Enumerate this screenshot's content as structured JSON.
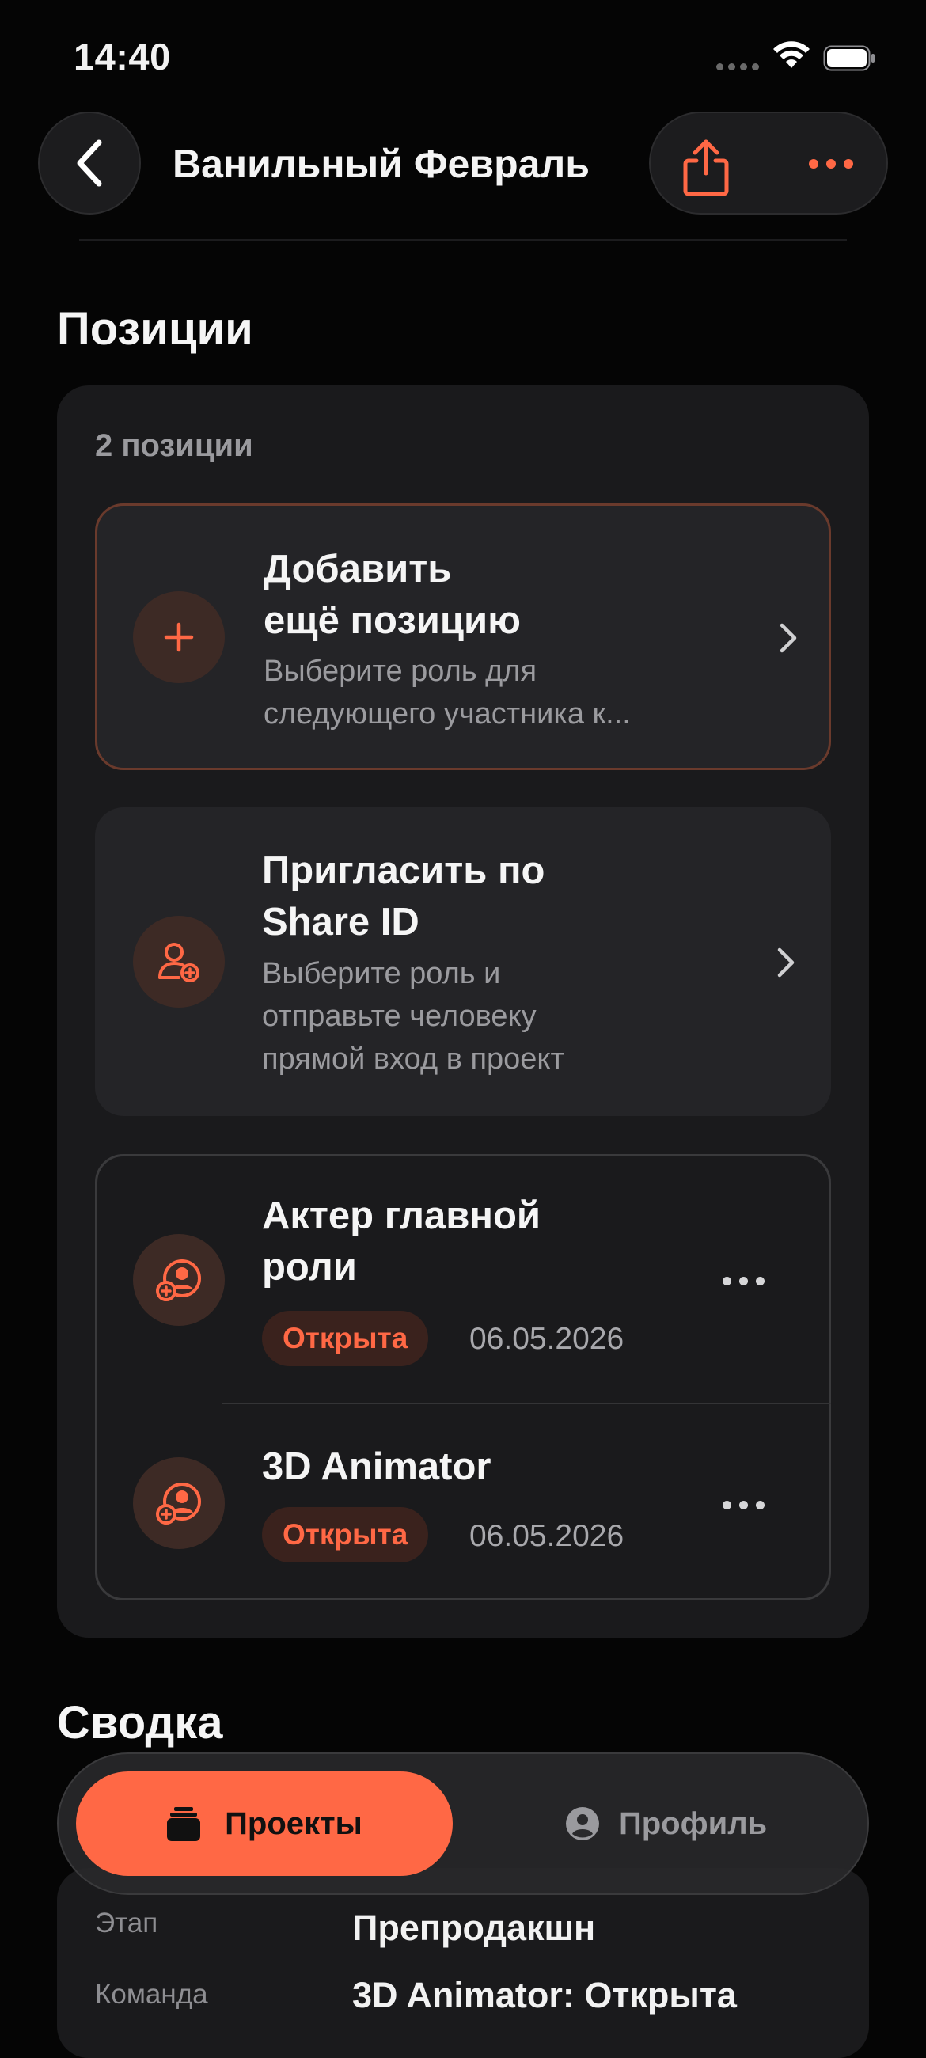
{
  "status_bar": {
    "time": "14:40"
  },
  "header": {
    "title": "Ванильный Февраль"
  },
  "positions": {
    "section_title": "Позиции",
    "count_label": "2 позиции",
    "add": {
      "title_line1": "Добавить",
      "title_line2": "ещё позицию",
      "sub_line1": "Выберите роль для",
      "sub_line2": "следующего участника к..."
    },
    "invite": {
      "title_line1": "Пригласить по",
      "title_line2": "Share ID",
      "sub_line1": "Выберите роль и",
      "sub_line2": "отправьте человеку",
      "sub_line3": "прямой вход в проект"
    },
    "roles": [
      {
        "title_line1": "Актер главной",
        "title_line2": "роли",
        "status": "Открыта",
        "date": "06.05.2026"
      },
      {
        "title_line1": "3D Animator",
        "title_line2": "",
        "status": "Открыта",
        "date": "06.05.2026"
      }
    ]
  },
  "summary": {
    "section_title": "Сводка",
    "rows": [
      {
        "label": "Этап",
        "value": "Препродакшн"
      },
      {
        "label": "Команда",
        "value": "3D Animator: Открыта"
      }
    ]
  },
  "tabbar": {
    "projects_label": "Проекты",
    "profile_label": "Профиль"
  },
  "colors": {
    "accent": "#ff6845",
    "background": "#050505",
    "card": "#1a1a1c"
  },
  "icons": [
    "back-chevron-icon",
    "share-icon",
    "more-icon",
    "plus-icon",
    "add-person-icon",
    "chevron-right-icon",
    "role-add-icon",
    "projects-icon",
    "profile-icon",
    "wifi-icon",
    "battery-icon"
  ]
}
